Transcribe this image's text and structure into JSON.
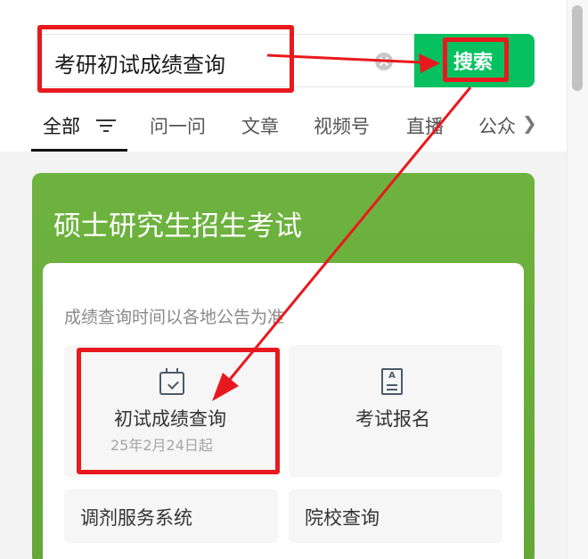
{
  "search": {
    "query": "考研初试成绩查询",
    "button_label": "搜索"
  },
  "tabs": [
    {
      "label": "全部",
      "active": true
    },
    {
      "label": "问一问"
    },
    {
      "label": "文章"
    },
    {
      "label": "视频号"
    },
    {
      "label": "直播"
    },
    {
      "label": "公众"
    }
  ],
  "card": {
    "title": "硕士研究生招生考试",
    "note": "成绩查询时间以各地公告为准",
    "tiles": [
      {
        "label": "初试成绩查询",
        "sub": "25年2月24日起",
        "icon": "calendar-check-icon"
      },
      {
        "label": "考试报名",
        "icon": "document-icon",
        "icon_letter": "A"
      },
      {
        "label": "调剂服务系统"
      },
      {
        "label": "院校查询"
      }
    ]
  },
  "colors": {
    "accent_green": "#07c160",
    "card_green": "#6eb33f",
    "annotation_red": "#e8191e"
  }
}
